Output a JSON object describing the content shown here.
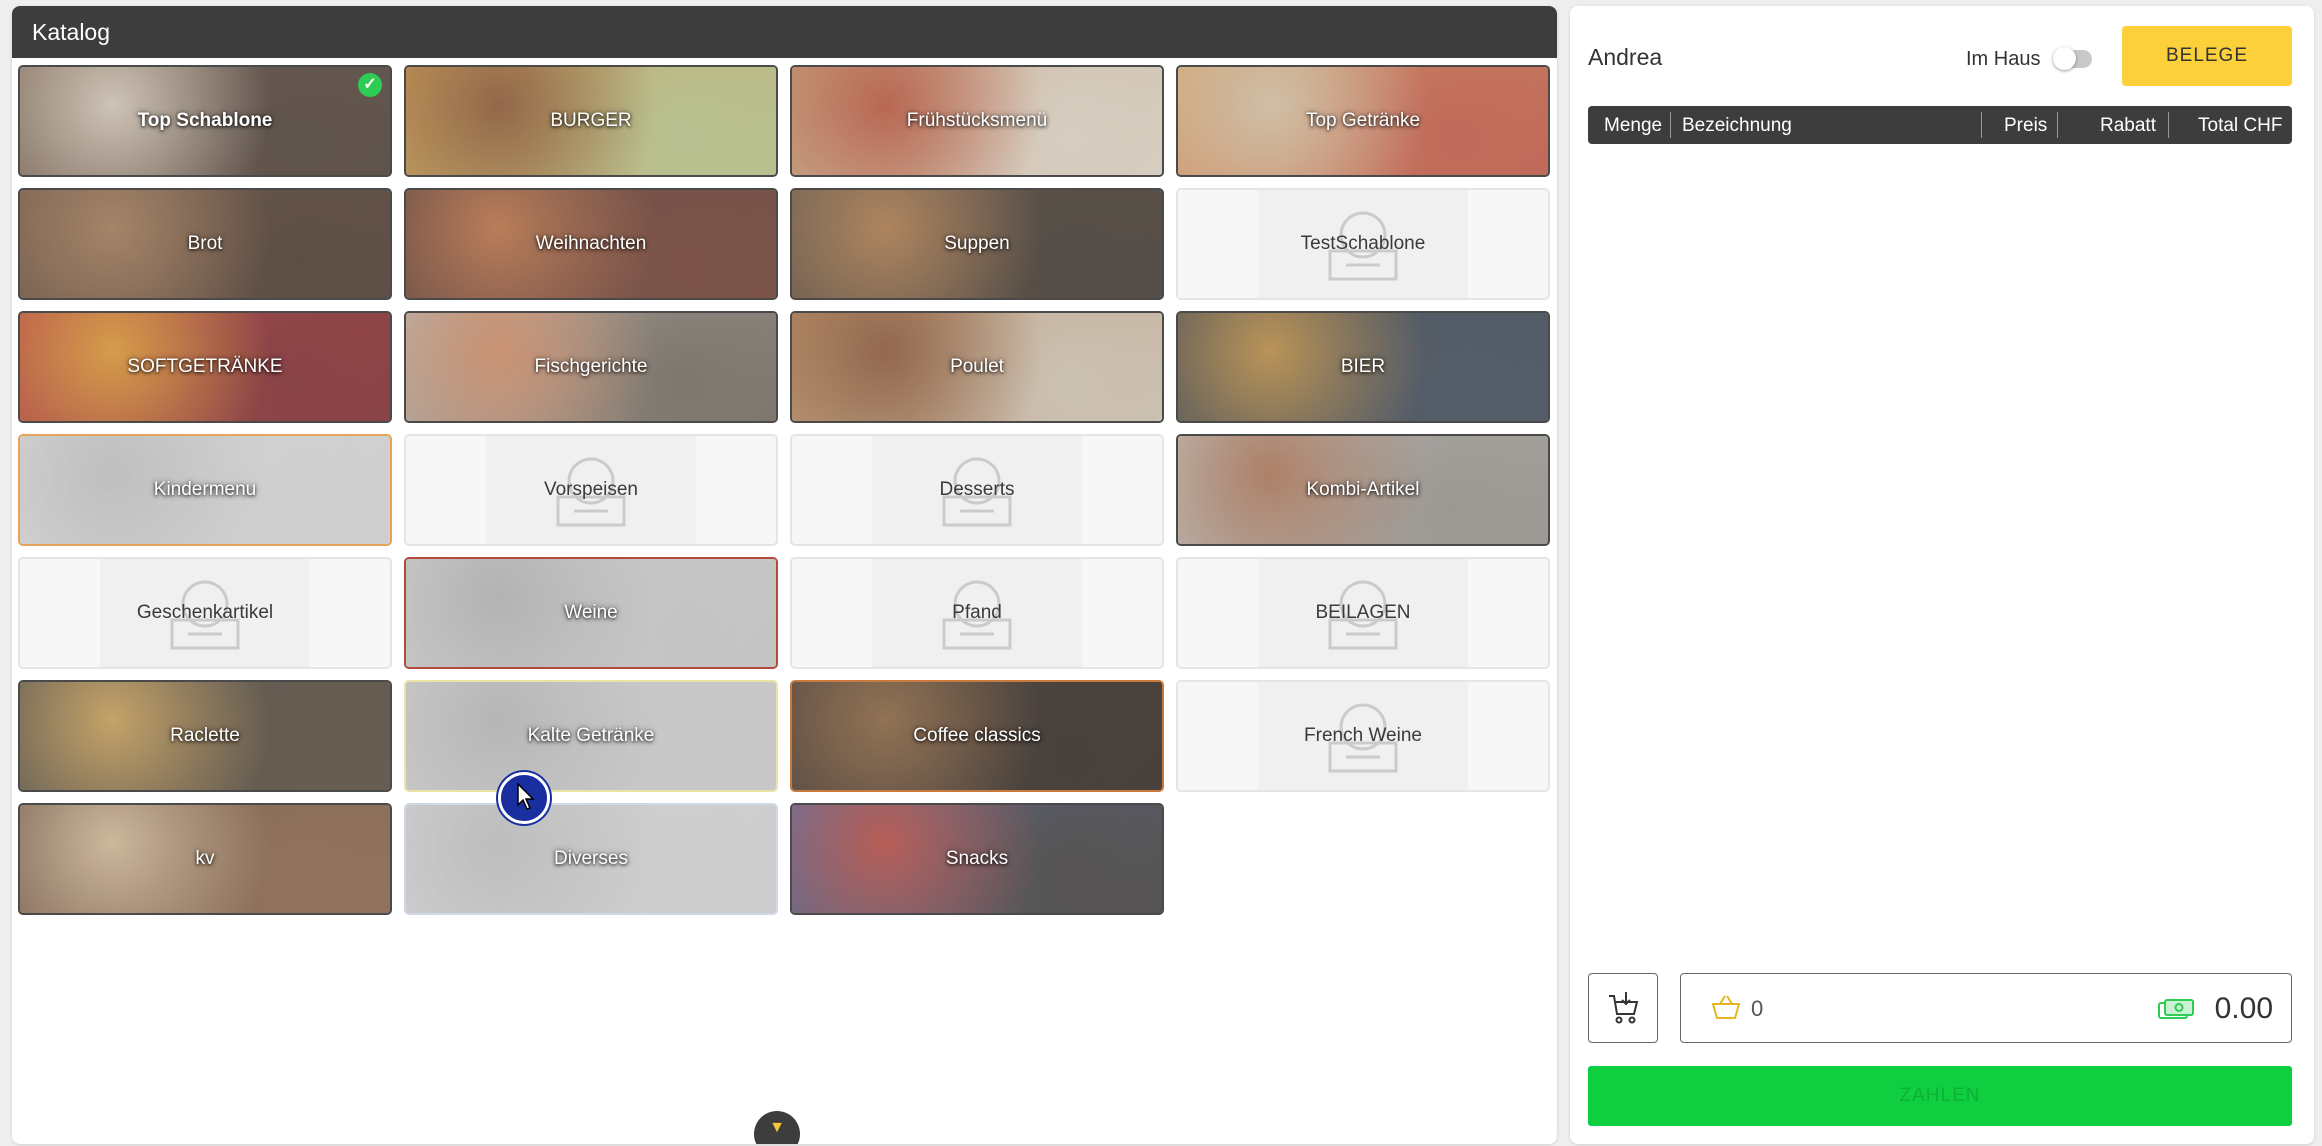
{
  "catalog": {
    "title": "Katalog",
    "tiles": [
      {
        "label": "Top Schablone",
        "kind": "photo",
        "selected": true,
        "colors": [
          "#6b4a32",
          "#e6d6c2",
          "#3c2a1f"
        ]
      },
      {
        "label": "BURGER",
        "kind": "photo",
        "colors": [
          "#e39b2e",
          "#8a4a1c",
          "#c4d38a"
        ]
      },
      {
        "label": "Frühstücksmenü",
        "kind": "photo",
        "colors": [
          "#d9a66b",
          "#c64a2c",
          "#f3e6d3"
        ]
      },
      {
        "label": "Top Getränke",
        "kind": "photo",
        "colors": [
          "#f0a85a",
          "#e8cfa9",
          "#d24c35"
        ]
      },
      {
        "label": "Brot",
        "kind": "photo",
        "colors": [
          "#5b3a22",
          "#a8754a",
          "#3b2416"
        ]
      },
      {
        "label": "Weihnachten",
        "kind": "photo",
        "colors": [
          "#3d1c14",
          "#c86a34",
          "#6a2c1d"
        ]
      },
      {
        "label": "Suppen",
        "kind": "photo",
        "colors": [
          "#4a3828",
          "#b5763c",
          "#2e2218"
        ]
      },
      {
        "label": "TestSchablone",
        "kind": "plain"
      },
      {
        "label": "SOFTGETRÄNKE",
        "kind": "photo",
        "colors": [
          "#c21f24",
          "#f29a1d",
          "#7c1216"
        ]
      },
      {
        "label": "Fischgerichte",
        "kind": "photo",
        "colors": [
          "#c9c2b6",
          "#e08a5a",
          "#6b6154"
        ]
      },
      {
        "label": "Poulet",
        "kind": "photo",
        "colors": [
          "#c98a4a",
          "#8b4a22",
          "#e2d2bc"
        ]
      },
      {
        "label": "BIER",
        "kind": "photo",
        "colors": [
          "#1d2633",
          "#c88d32",
          "#2c3a4c"
        ]
      },
      {
        "label": "Kindermenu",
        "kind": "sketch",
        "colors": [
          "#f3f3f3",
          "#cfcfcf",
          "#e8e8e8"
        ],
        "border": "#e8a35a"
      },
      {
        "label": "Vorspeisen",
        "kind": "plain"
      },
      {
        "label": "Desserts",
        "kind": "plain"
      },
      {
        "label": "Kombi-Artikel",
        "kind": "photo",
        "colors": [
          "#d6d2cc",
          "#b4704a",
          "#9a958e"
        ]
      },
      {
        "label": "Geschenkartikel",
        "kind": "plain"
      },
      {
        "label": "Weine",
        "kind": "sketch",
        "colors": [
          "#e6e6e6",
          "#bdbdbd",
          "#d8d8d8"
        ],
        "border": "#b24a3a"
      },
      {
        "label": "Pfand",
        "kind": "plain"
      },
      {
        "label": "BEILAGEN",
        "kind": "plain"
      },
      {
        "label": "Raclette",
        "kind": "photo",
        "colors": [
          "#2b2b2b",
          "#d9a44a",
          "#4a3a28"
        ]
      },
      {
        "label": "Kalte Getränke",
        "kind": "sketch",
        "colors": [
          "#e6e6e6",
          "#c2c2c2",
          "#dcdcdc"
        ],
        "border": "#e9e3a8"
      },
      {
        "label": "Coffee classics",
        "kind": "photo",
        "colors": [
          "#2a1810",
          "#8a5a2c",
          "#1a0f08"
        ],
        "border": "#c87a3c"
      },
      {
        "label": "French Weine",
        "kind": "plain"
      },
      {
        "label": "kv",
        "kind": "photo",
        "colors": [
          "#5a3a24",
          "#e4c49a",
          "#8a5a38"
        ]
      },
      {
        "label": "Diverses",
        "kind": "sketch",
        "colors": [
          "#eeeeee",
          "#cccccc",
          "#e4e4e4"
        ],
        "border": "#cfd9e6"
      },
      {
        "label": "Snacks",
        "kind": "photo",
        "colors": [
          "#3c5ea8",
          "#c23a2e",
          "#2e2a28"
        ]
      }
    ]
  },
  "order": {
    "user": "Andrea",
    "inhaus_label": "Im Haus",
    "belege_label": "BELEGE",
    "columns": {
      "menge": "Menge",
      "bezeichnung": "Bezeichnung",
      "preis": "Preis",
      "rabatt": "Rabatt",
      "total": "Total CHF"
    },
    "item_count": "0",
    "total": "0.00",
    "pay_label": "ZAHLEN"
  },
  "icons": {
    "check": "check-icon",
    "scroll": "chevron-down-icon",
    "placeholder": "placeholder-image-icon",
    "cart": "cart-add-icon",
    "basket": "basket-icon",
    "cash": "cash-icon"
  },
  "colors": {
    "header": "#3d3d3d",
    "accent_yellow": "#fbd03b",
    "pay_green": "#0fcf40",
    "check_green": "#2ecc55"
  }
}
